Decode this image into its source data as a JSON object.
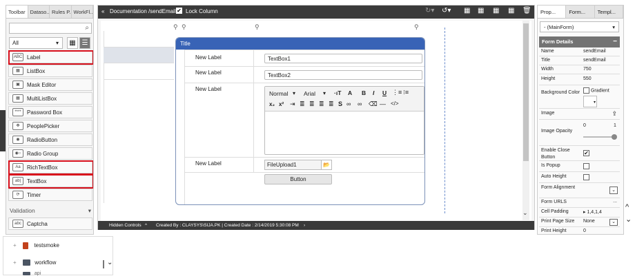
{
  "left_panel": {
    "tabs": [
      "Toolbar",
      "Dataso...",
      "Rules P...",
      "WorkFl..."
    ],
    "filter_value": "All",
    "items": [
      {
        "label": "Label",
        "icon": "label-icon",
        "icon_text": "ABC"
      },
      {
        "label": "ListBox",
        "icon": "listbox-icon",
        "icon_text": "▦"
      },
      {
        "label": "Mask Editor",
        "icon": "mask-editor-icon",
        "icon_text": "▣"
      },
      {
        "label": "MultiListBox",
        "icon": "multilistbox-icon",
        "icon_text": "▦"
      },
      {
        "label": "Password Box",
        "icon": "password-box-icon",
        "icon_text": "****"
      },
      {
        "label": "PeoplePicker",
        "icon": "people-picker-icon",
        "icon_text": "✥"
      },
      {
        "label": "RadioButton",
        "icon": "radio-button-icon",
        "icon_text": "◉"
      },
      {
        "label": "Radio Group",
        "icon": "radio-group-icon",
        "icon_text": "◉○"
      },
      {
        "label": "RichTextBox",
        "icon": "richtextbox-icon",
        "icon_text": "Aa"
      },
      {
        "label": "TextBox",
        "icon": "textbox-icon",
        "icon_text": "ab|"
      },
      {
        "label": "Timer",
        "icon": "timer-icon",
        "icon_text": "⟳"
      }
    ],
    "section_validation": "Validation",
    "validation_items": [
      {
        "label": "Captcha",
        "icon": "captcha-icon",
        "icon_text": "abc"
      }
    ]
  },
  "center": {
    "breadcrumb": "Documentation /sendEmail",
    "lock_column_label": "Lock Column",
    "form_title": "Title",
    "rows": [
      {
        "label": "New Label",
        "control": "TextBox1"
      },
      {
        "label": "New Label",
        "control": "TextBox2"
      },
      {
        "label": "New Label",
        "control": ""
      },
      {
        "label": "New Label",
        "control": "FileUpload1"
      }
    ],
    "rte_format": "Normal",
    "rte_font": "Arial",
    "button_label": "Button",
    "hidden_controls": "Hidden Controls",
    "created_info": "Created By : CLAYSYS\\SIJA.PK | Created Date : 2/14/2019 5:30:08 PM"
  },
  "right_panel": {
    "tabs": [
      "Prop...",
      "Form...",
      "Templ..."
    ],
    "selected": "- (MainForm)",
    "section_title": "Form Details",
    "properties": [
      {
        "key": "Name",
        "value": "sendEmail"
      },
      {
        "key": "Title",
        "value": "sendEmail"
      },
      {
        "key": "Width",
        "value": "750"
      },
      {
        "key": "Height",
        "value": "550"
      },
      {
        "key": "Background Color",
        "value": "Gradient"
      },
      {
        "key": "Image",
        "value": ""
      },
      {
        "key": "Image Opacity",
        "value": ""
      },
      {
        "key": "Enable Close Button",
        "value": ""
      },
      {
        "key": "Is Popup",
        "value": ""
      },
      {
        "key": "Auto Height",
        "value": ""
      },
      {
        "key": "Form Alignment",
        "value": ""
      },
      {
        "key": "Form URLS",
        "value": "..."
      },
      {
        "key": "Cell Padding",
        "value": "1,4,1,4"
      },
      {
        "key": "Print Page Size",
        "value": "None"
      },
      {
        "key": "Print Height",
        "value": "0"
      }
    ],
    "opacity_min": "0",
    "opacity_max": "1"
  },
  "tree": {
    "items": [
      "testsmoke",
      "workflow",
      "api"
    ]
  }
}
